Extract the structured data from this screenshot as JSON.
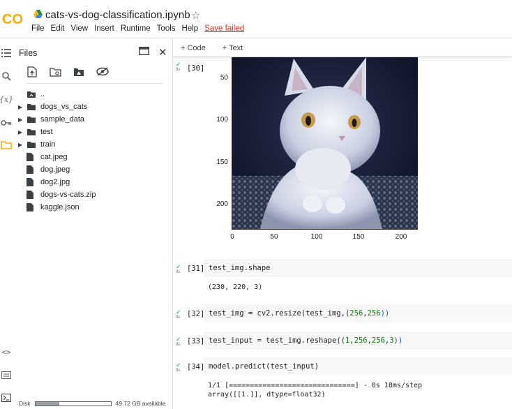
{
  "header": {
    "logo_text": "CO",
    "notebook_title": "cats-vs-dog-classification.ipynb",
    "menu": [
      "File",
      "Edit",
      "View",
      "Insert",
      "Runtime",
      "Tools",
      "Help"
    ],
    "save_status": "Save failed"
  },
  "files_panel": {
    "title": "Files",
    "tree": [
      {
        "name": "..",
        "type": "parent"
      },
      {
        "name": "dogs_vs_cats",
        "type": "folder"
      },
      {
        "name": "sample_data",
        "type": "folder"
      },
      {
        "name": "test",
        "type": "folder"
      },
      {
        "name": "train",
        "type": "folder"
      },
      {
        "name": "cat.jpeg",
        "type": "file"
      },
      {
        "name": "dog.jpeg",
        "type": "file"
      },
      {
        "name": "dog2.jpg",
        "type": "file"
      },
      {
        "name": "dogs-vs-cats.zip",
        "type": "file"
      },
      {
        "name": "kaggle.json",
        "type": "file"
      }
    ],
    "disk_label": "Disk",
    "disk_available": "49.72 GB available",
    "disk_used_fraction": 0.32
  },
  "toolbar": {
    "add_code": "+ Code",
    "add_text": "+ Text"
  },
  "cells": [
    {
      "exec": "[30]",
      "time": "0s"
    },
    {
      "exec": "[31]",
      "time": "0s",
      "code": "test_img.shape",
      "output": "(230, 220, 3)"
    },
    {
      "exec": "[32]",
      "time": "0s"
    },
    {
      "exec": "[33]",
      "time": "0s"
    },
    {
      "exec": "[34]",
      "time": "0s",
      "code": "model.predict(test_input)",
      "output1": "1/1 [==============================] - 0s 18ms/step",
      "output2": "array([[1.]], dtype=float32)"
    }
  ],
  "code32": {
    "a": "test_img = cv2.resize(test_img,(",
    "n1": "256",
    "c": ",",
    "n2": "256",
    "b": "))"
  },
  "code33": {
    "a": "test_input = test_img.reshape((",
    "n1": "1",
    "n2": "256",
    "n3": "256",
    "n4": "3",
    "b": "))"
  },
  "plot": {
    "y_ticks": [
      "50",
      "100",
      "150",
      "200"
    ],
    "x_ticks": [
      "0",
      "50",
      "100",
      "150",
      "200"
    ]
  },
  "colors": {
    "accent_orange": "#f9ab00",
    "check_green": "#0f9d58",
    "error_red": "#d93025"
  }
}
